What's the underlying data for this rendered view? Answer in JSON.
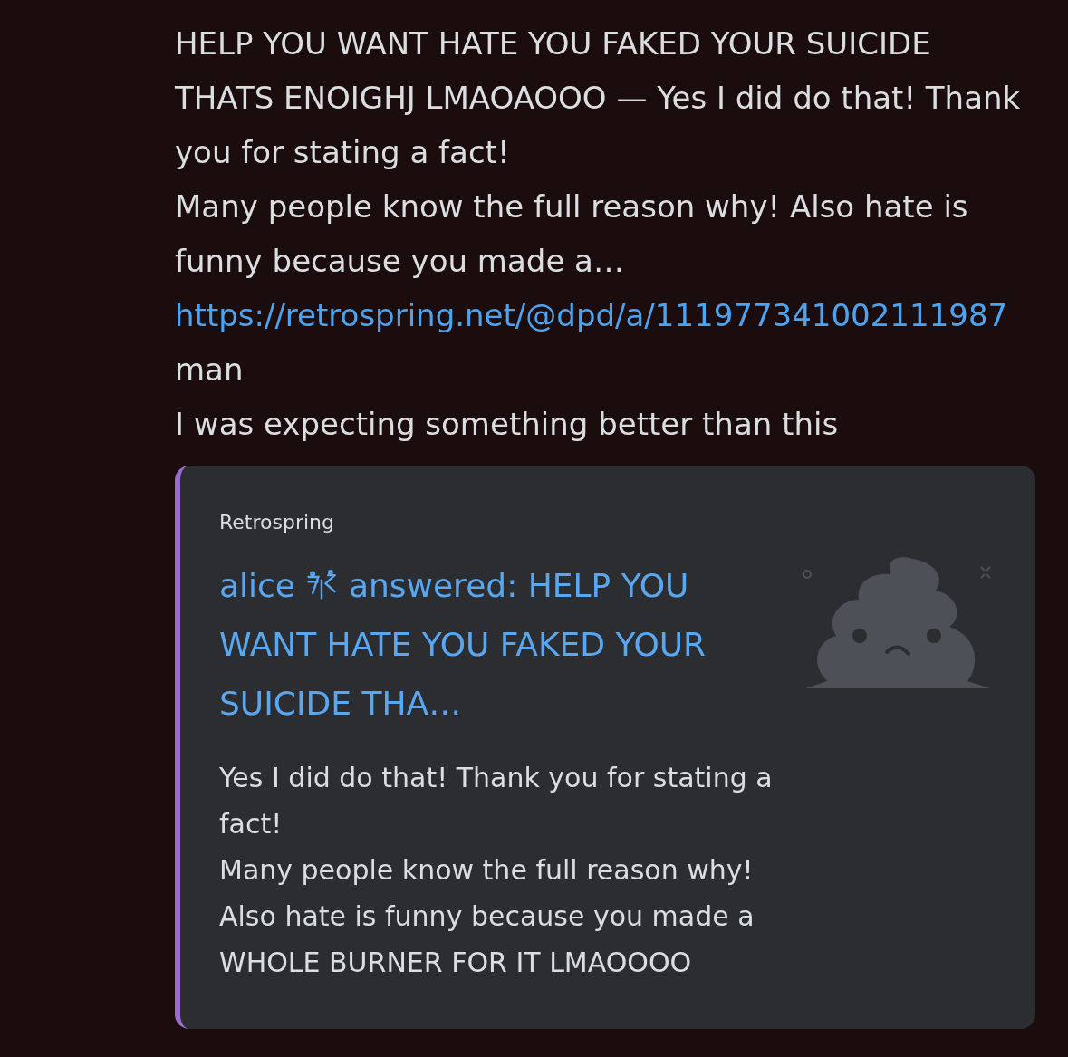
{
  "message": {
    "content": [
      {
        "kind": "text",
        "text": "HELP YOU WANT HATE YOU FAKED YOUR SUICIDE THATS ENOIGHJ LMAOAOOO — Yes I did do that! Thank you for stating a fact!\nMany people know the full reason why! Also hate is funny because you made a… "
      },
      {
        "kind": "link",
        "text": "https://retrospring.net/@dpd/a/111977341002111987"
      },
      {
        "kind": "text",
        "text": " man\nI was expecting something better than this"
      }
    ]
  },
  "embed": {
    "provider": "Retrospring",
    "author_name": "alice",
    "title": "answered: HELP YOU WANT HATE YOU FAKED YOUR SUICIDE THA…",
    "description": "Yes I did do that! Thank you for stating a fact!\nMany people know the full reason why! Also hate is funny because you made a WHOLE BURNER FOR IT LMAOOOO"
  }
}
